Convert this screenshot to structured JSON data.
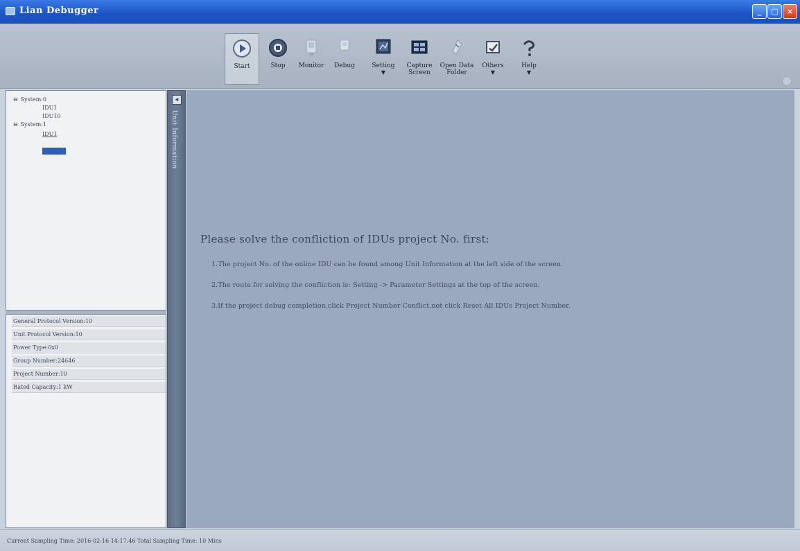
{
  "window": {
    "title": "Lian Debugger",
    "buttons": {
      "minimize": "_",
      "maximize": "□",
      "close": "×"
    }
  },
  "toolbar": {
    "items": [
      {
        "label": "Start",
        "icon": "play-icon",
        "active": true
      },
      {
        "label": "Stop",
        "icon": "stop-icon"
      },
      {
        "label": "Monitor",
        "icon": "monitor-icon"
      },
      {
        "label": "Debug",
        "icon": "debug-icon"
      },
      {
        "label": "Setting",
        "icon": "setting-icon",
        "dropdown": true
      },
      {
        "label": "Capture Screen",
        "icon": "capture-screen-icon"
      },
      {
        "label": "Open Data Folder",
        "icon": "folder-icon"
      },
      {
        "label": "Others",
        "icon": "others-icon",
        "dropdown": true
      },
      {
        "label": "Help",
        "icon": "help-icon",
        "dropdown": true
      }
    ],
    "dropdown_arrow": "▼"
  },
  "tree": {
    "nodes": [
      {
        "label": "System:0",
        "expander": "⊟"
      },
      {
        "label": "IDU1"
      },
      {
        "label": "IDU10"
      },
      {
        "label": "System:1",
        "expander": "⊟"
      },
      {
        "label": "IDU1"
      },
      {
        "label": "IDU2"
      }
    ]
  },
  "vertical_tab": {
    "label": "Unit Information",
    "pin": "◂"
  },
  "info": {
    "rows": [
      "General Protocol Version:10",
      "Unit Protocol Version:10",
      "Power Type:0x0",
      "Group Number:24646",
      "Project Number:10",
      "Rated Capacity:1 kW"
    ]
  },
  "message": {
    "title": "Please solve the confliction of IDUs project No. first:",
    "lines": [
      "1.The project No. of the online IDU can be found among Unit Information at the left side of the screen.",
      "2.The route for solving the confliction is: Setting -> Parameter Settings at the top of the screen.",
      "3.If the project debug completion,click Project Number Conflict,not click Reset All IDUs Project Number."
    ]
  },
  "status": {
    "text": "Current Sampling Time: 2016-02-16 14:17:46  Total Sampling Time: 10 Mins"
  },
  "colors": {
    "title_bar": "#1c55c8",
    "toolbar": "#a7b2c1",
    "main_bg": "#9aa9c0",
    "panel_bg": "#f1f2f4",
    "selection": "#2f5fb6"
  }
}
